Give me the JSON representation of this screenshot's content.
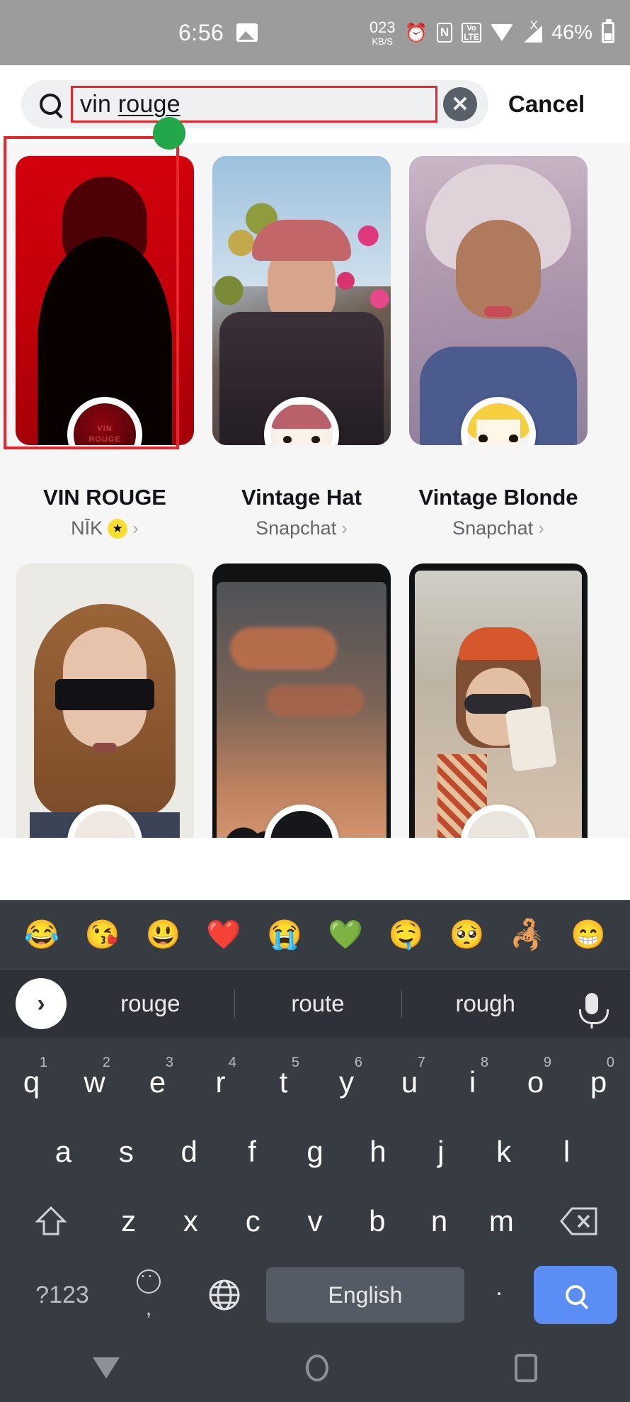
{
  "status_bar": {
    "time": "6:56",
    "photo_icon": "image-icon",
    "data_rate": "023",
    "data_unit": "KB/S",
    "alarm_icon": "alarm-clock-icon",
    "nfc_label": "N",
    "volte_top": "Vo",
    "volte_bottom": "LTE",
    "wifi_icon": "wifi-icon",
    "signal_icon": "signal-no-sim-icon",
    "signal_x": "X",
    "battery_percent": "46%",
    "battery_icon": "battery-icon"
  },
  "search": {
    "icon": "search-icon",
    "query_prefix": "vin ",
    "query_misspelled": "rouge",
    "full_query": "vin rouge",
    "clear_label": "✕",
    "cancel_label": "Cancel",
    "highlight_color": "#e8252a",
    "marker_color": "#22a84a"
  },
  "results": {
    "row1": [
      {
        "title": "VIN ROUGE",
        "author": "NĪK",
        "verified": true,
        "verified_glyph": "★",
        "chevron": "›",
        "highlighted": true
      },
      {
        "title": "Vintage Hat",
        "author": "Snapchat",
        "verified": false,
        "chevron": "›",
        "highlighted": false
      },
      {
        "title": "Vintage Blonde",
        "author": "Snapchat",
        "verified": false,
        "chevron": "›",
        "highlighted": false
      }
    ],
    "row2_visible_thumbs": 3,
    "avatar_badge_text_line1": "VIN",
    "avatar_badge_text_line2": "ROUGE"
  },
  "keyboard": {
    "emoji_row": [
      "😂",
      "😘",
      "😃",
      "❤️",
      "😭",
      "💚",
      "🤤",
      "🥺",
      "🦂",
      "😁"
    ],
    "suggestions": [
      "rouge",
      "route",
      "rough"
    ],
    "expand_glyph": "›",
    "mic_icon": "microphone-icon",
    "row1": [
      {
        "key": "q",
        "num": "1"
      },
      {
        "key": "w",
        "num": "2"
      },
      {
        "key": "e",
        "num": "3"
      },
      {
        "key": "r",
        "num": "4"
      },
      {
        "key": "t",
        "num": "5"
      },
      {
        "key": "y",
        "num": "6"
      },
      {
        "key": "u",
        "num": "7"
      },
      {
        "key": "i",
        "num": "8"
      },
      {
        "key": "o",
        "num": "9"
      },
      {
        "key": "p",
        "num": "0"
      }
    ],
    "row2": [
      "a",
      "s",
      "d",
      "f",
      "g",
      "h",
      "j",
      "k",
      "l"
    ],
    "row3": [
      "z",
      "x",
      "c",
      "v",
      "b",
      "n",
      "m"
    ],
    "shift_icon": "shift-icon",
    "backspace_icon": "backspace-icon",
    "numbers_key": "?123",
    "emoji_key_icon": "emoji-face-icon",
    "comma_key": ",",
    "globe_icon": "language-globe-icon",
    "space_label": "English",
    "period_key": ".",
    "search_key_icon": "search-icon",
    "search_key_color": "#5b8ef4"
  },
  "navbar": {
    "back_icon": "back-dismiss-keyboard-icon",
    "home_icon": "home-circle-icon",
    "recents_icon": "recent-apps-icon"
  }
}
